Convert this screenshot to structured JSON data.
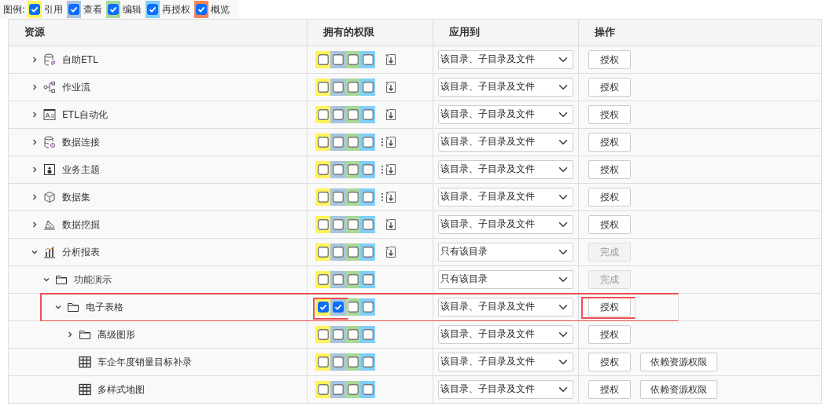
{
  "legend": {
    "label": "图例:",
    "items": [
      {
        "label": "引用",
        "checked": true,
        "color": "#fff35c"
      },
      {
        "label": "查看",
        "checked": true,
        "color": "#a8c4e0"
      },
      {
        "label": "编辑",
        "checked": true,
        "color": "#a8d89a"
      },
      {
        "label": "再授权",
        "checked": true,
        "color": "#80cff8"
      },
      {
        "label": "概览",
        "checked": true,
        "color": "#f4845a"
      }
    ]
  },
  "table": {
    "columns": [
      "资源",
      "拥有的权限",
      "应用到",
      "操作"
    ],
    "rows": [
      {
        "label": "自助ETL",
        "kind": "etl-db",
        "expanded": false,
        "perms": [
          false,
          false,
          false,
          false
        ],
        "more_menu": false,
        "import_icon": true,
        "apply_to": "该目录、子目录及文件",
        "buttons": [
          {
            "label": "授权",
            "disabled": false
          }
        ]
      },
      {
        "label": "作业流",
        "kind": "workflow",
        "expanded": false,
        "perms": [
          false,
          false,
          false,
          false
        ],
        "more_menu": false,
        "import_icon": true,
        "apply_to": "该目录、子目录及文件",
        "buttons": [
          {
            "label": "授权",
            "disabled": false
          }
        ]
      },
      {
        "label": "ETL自动化",
        "kind": "automation",
        "expanded": false,
        "perms": [
          false,
          false,
          false,
          false
        ],
        "more_menu": false,
        "import_icon": true,
        "apply_to": "该目录、子目录及文件",
        "buttons": [
          {
            "label": "授权",
            "disabled": false
          }
        ]
      },
      {
        "label": "数据连接",
        "kind": "connection",
        "expanded": false,
        "perms": [
          false,
          false,
          false,
          false
        ],
        "more_menu": true,
        "import_icon": true,
        "apply_to": "该目录、子目录及文件",
        "buttons": [
          {
            "label": "授权",
            "disabled": false
          }
        ]
      },
      {
        "label": "业务主题",
        "kind": "subject",
        "expanded": false,
        "perms": [
          false,
          false,
          false,
          false
        ],
        "more_menu": true,
        "import_icon": true,
        "apply_to": "该目录、子目录及文件",
        "buttons": [
          {
            "label": "授权",
            "disabled": false
          }
        ]
      },
      {
        "label": "数据集",
        "kind": "cube",
        "expanded": false,
        "perms": [
          false,
          false,
          false,
          false
        ],
        "more_menu": true,
        "import_icon": true,
        "apply_to": "该目录、子目录及文件",
        "buttons": [
          {
            "label": "授权",
            "disabled": false
          }
        ]
      },
      {
        "label": "数据挖掘",
        "kind": "mining",
        "expanded": false,
        "perms": [
          false,
          false,
          false,
          false
        ],
        "more_menu": false,
        "import_icon": true,
        "apply_to": "该目录、子目录及文件",
        "buttons": [
          {
            "label": "授权",
            "disabled": false
          }
        ]
      },
      {
        "label": "分析报表",
        "kind": "chart",
        "expanded": true,
        "perms": [
          false,
          false,
          false,
          false
        ],
        "more_menu": false,
        "import_icon": true,
        "apply_to": "只有该目录",
        "buttons": [
          {
            "label": "完成",
            "disabled": true
          }
        ],
        "children": [
          {
            "label": "功能演示",
            "kind": "folder",
            "expanded": true,
            "perms": [
              false,
              false,
              false,
              false
            ],
            "more_menu": false,
            "import_icon": false,
            "apply_to": "只有该目录",
            "buttons": [
              {
                "label": "完成",
                "disabled": true
              }
            ],
            "children": [
              {
                "label": "电子表格",
                "kind": "folder",
                "expanded": true,
                "highlighted": true,
                "perms": [
                  true,
                  true,
                  false,
                  false
                ],
                "more_menu": false,
                "import_icon": false,
                "apply_to": "该目录、子目录及文件",
                "buttons": [
                  {
                    "label": "授权",
                    "disabled": false
                  }
                ],
                "children": [
                  {
                    "label": "高级图形",
                    "kind": "folder",
                    "expanded": false,
                    "perms": [
                      false,
                      false,
                      false,
                      false
                    ],
                    "more_menu": false,
                    "import_icon": false,
                    "apply_to": "该目录、子目录及文件",
                    "buttons": [
                      {
                        "label": "授权",
                        "disabled": false
                      }
                    ]
                  },
                  {
                    "label": "车企年度销量目标补录",
                    "kind": "grid",
                    "perms": [
                      false,
                      false,
                      false,
                      false
                    ],
                    "more_menu": false,
                    "import_icon": false,
                    "apply_to": "该目录、子目录及文件",
                    "buttons": [
                      {
                        "label": "授权",
                        "disabled": false
                      },
                      {
                        "label": "依赖资源权限",
                        "disabled": false
                      }
                    ]
                  },
                  {
                    "label": "多样式地图",
                    "kind": "grid",
                    "perms": [
                      false,
                      false,
                      false,
                      false
                    ],
                    "more_menu": false,
                    "import_icon": false,
                    "apply_to": "该目录、子目录及文件",
                    "buttons": [
                      {
                        "label": "授权",
                        "disabled": false
                      },
                      {
                        "label": "依赖资源权限",
                        "disabled": false
                      }
                    ]
                  }
                ]
              }
            ]
          }
        ]
      }
    ]
  }
}
